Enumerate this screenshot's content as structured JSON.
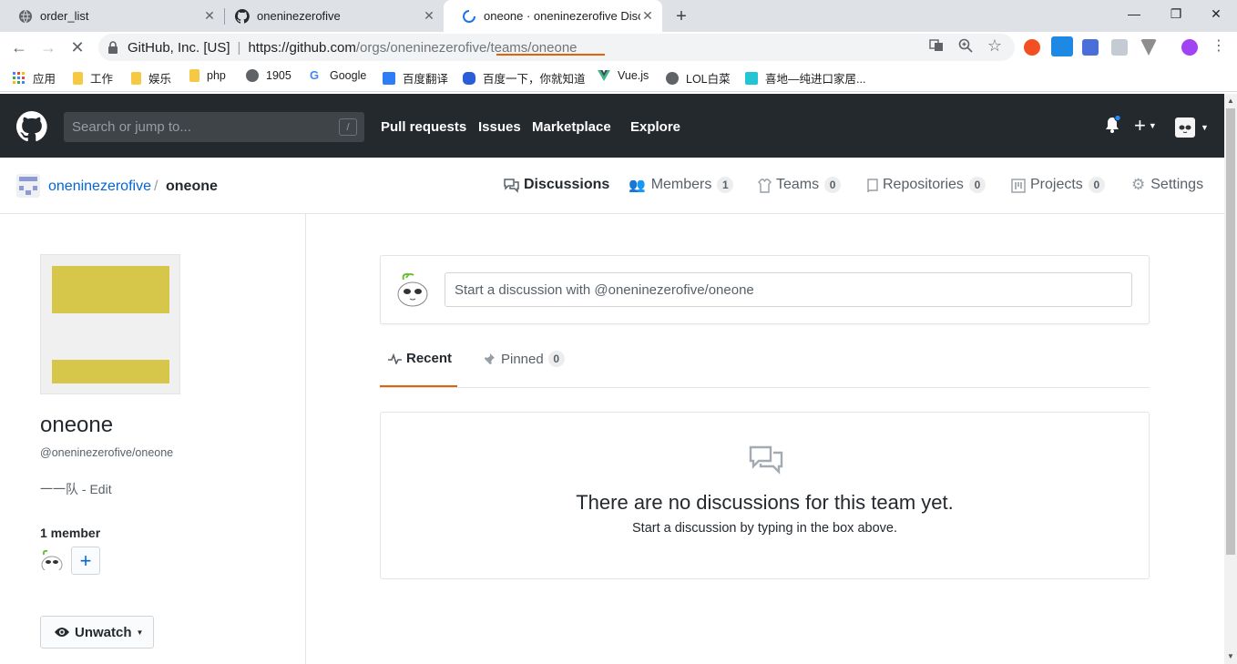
{
  "browser": {
    "tabs": [
      {
        "title": "order_list"
      },
      {
        "title": "oneninezerofive"
      },
      {
        "title": "oneone · oneninezerofive Disc"
      }
    ],
    "omnibox": {
      "site": "GitHub, Inc. [US]",
      "url_host": "https://github.com",
      "url_path": "/orgs/oneninezerofive/teams/oneone"
    },
    "bookmarks": [
      "应用",
      "工作",
      "娱乐",
      "php",
      "1905",
      "Google",
      "百度翻译",
      "百度一下，你就知道",
      "Vue.js",
      "LOL白菜",
      "喜地—纯进口家居..."
    ]
  },
  "header": {
    "search_placeholder": "Search or jump to...",
    "search_shortcut": "/",
    "nav": [
      "Pull requests",
      "Issues",
      "Marketplace",
      "Explore"
    ],
    "plus_label": "+"
  },
  "team_nav": {
    "org": "oneninezerofive",
    "separator": "/",
    "team": "oneone",
    "tabs": [
      {
        "label": "Discussions"
      },
      {
        "label": "Members",
        "count": "1"
      },
      {
        "label": "Teams",
        "count": "0"
      },
      {
        "label": "Repositories",
        "count": "0"
      },
      {
        "label": "Projects",
        "count": "0"
      },
      {
        "label": "Settings"
      }
    ]
  },
  "sidebar": {
    "team_name": "oneone",
    "handle": "@oneninezerofive/oneone",
    "description": "一一队",
    "edit_label": "Edit",
    "members_heading": "1 member",
    "add_label": "+",
    "unwatch_label": "Unwatch"
  },
  "main": {
    "compose_placeholder": "Start a discussion with @oneninezerofive/oneone",
    "subtabs": [
      {
        "label": "Recent"
      },
      {
        "label": "Pinned",
        "count": "0"
      }
    ],
    "blank_title": "There are no discussions for this team yet.",
    "blank_subtitle": "Start a discussion by typing in the box above."
  },
  "colors": {
    "header_bg": "#24292e",
    "link": "#0366d6",
    "accent_underline": "#e36209",
    "avatar_yellow": "#d6c74a"
  }
}
